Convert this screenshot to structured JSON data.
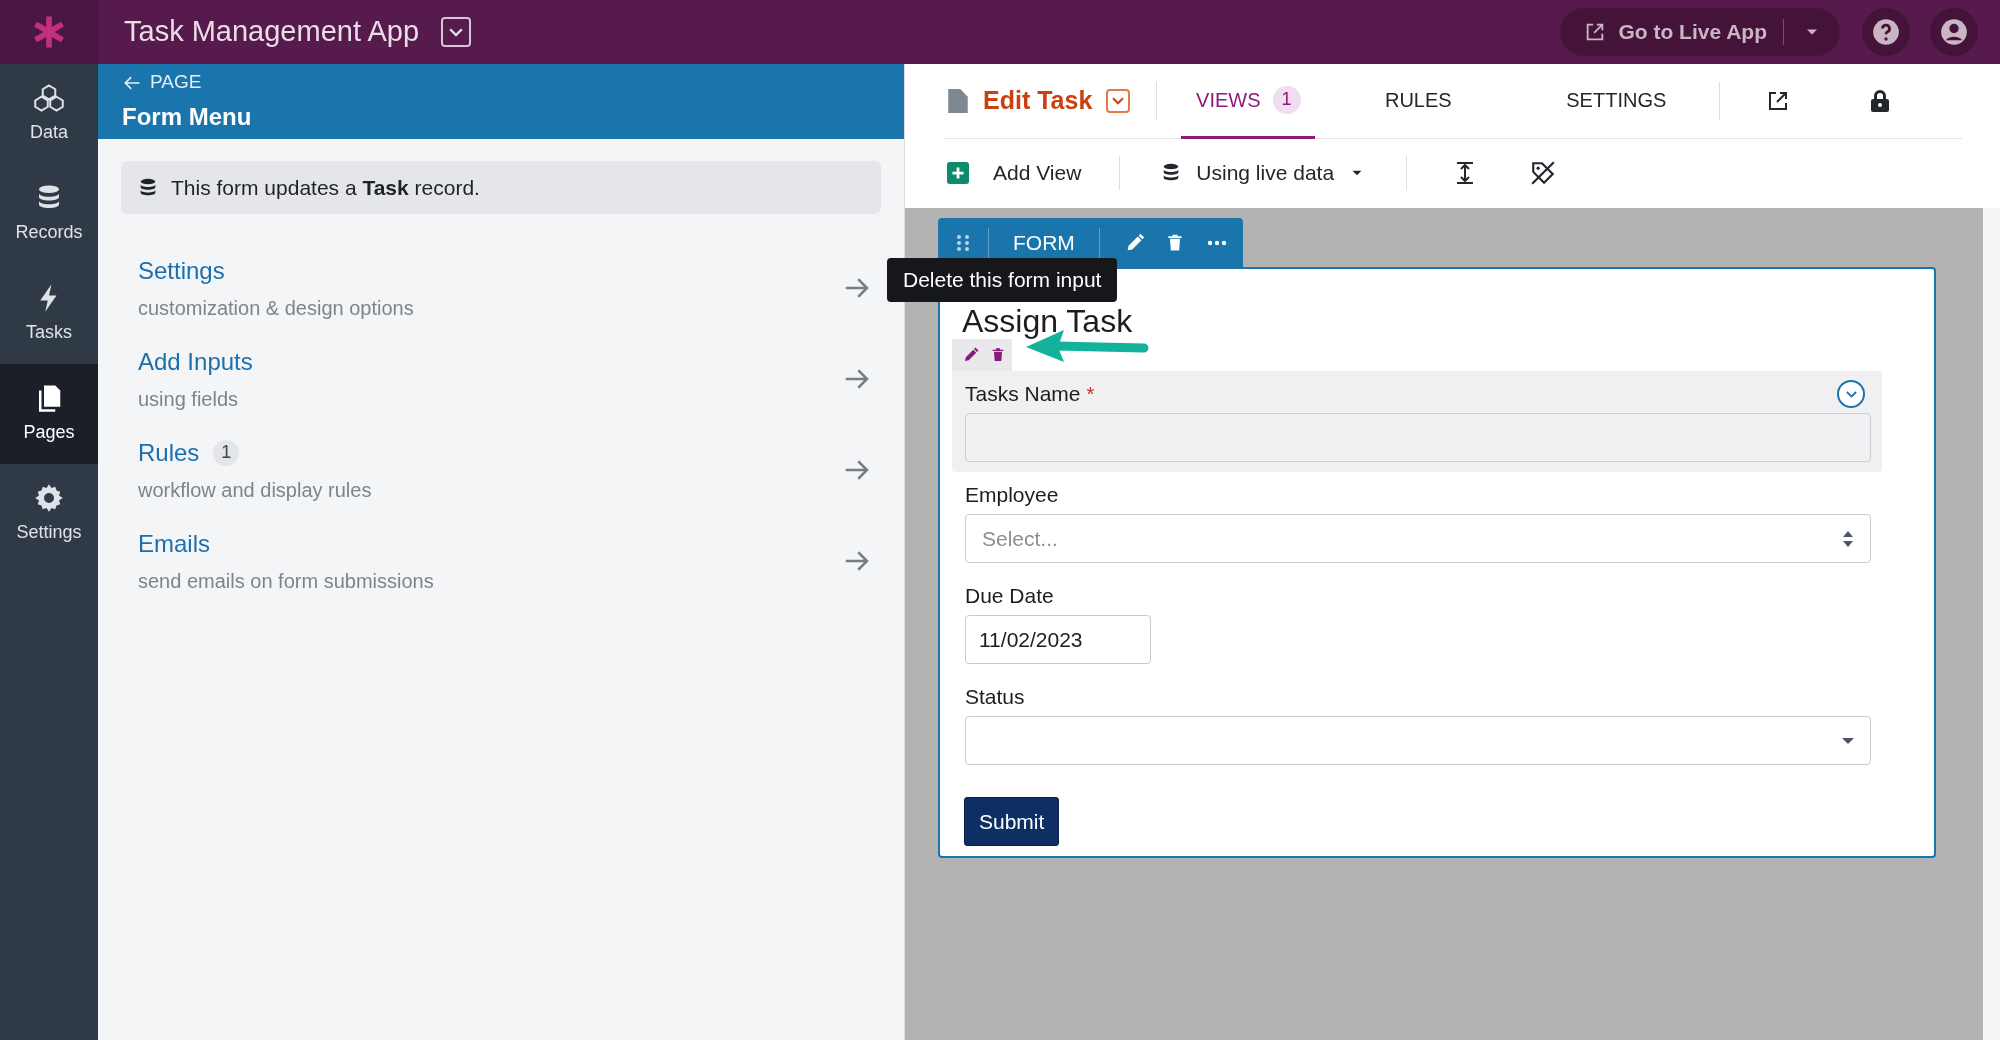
{
  "app_bar": {
    "title": "Task Management App",
    "live_app_button": "Go to Live App"
  },
  "nav": [
    {
      "label": "Data",
      "selected": false
    },
    {
      "label": "Records",
      "selected": false
    },
    {
      "label": "Tasks",
      "selected": false
    },
    {
      "label": "Pages",
      "selected": true
    },
    {
      "label": "Settings",
      "selected": false
    }
  ],
  "panel": {
    "back_label": "PAGE",
    "title": "Form Menu",
    "notice": "This form updates a **Task** record.",
    "items": [
      {
        "title": "Settings",
        "subtitle": "customization & design options"
      },
      {
        "title": "Add Inputs",
        "subtitle": "using fields"
      },
      {
        "title": "Rules",
        "count": "1",
        "subtitle": "workflow and display rules"
      },
      {
        "title": "Emails",
        "subtitle": "send emails on form submissions"
      }
    ]
  },
  "editor": {
    "page_name": "Edit Task",
    "tabs": [
      {
        "label": "VIEWS",
        "count": "1",
        "selected": true
      },
      {
        "label": "RULES",
        "selected": false
      },
      {
        "label": "SETTINGS",
        "selected": false
      }
    ],
    "toolbar": {
      "add_view": "Add View",
      "data_mode": "Using live data"
    }
  },
  "form": {
    "tab_label": "FORM",
    "tooltip": "Delete this form input",
    "title": "Assign Task",
    "fields": [
      {
        "kind": "text",
        "label": "Tasks Name",
        "required_mark": "*",
        "selected": true
      },
      {
        "kind": "select",
        "label": "Employee",
        "placeholder": "Select...",
        "selected": false
      },
      {
        "kind": "date",
        "label": "Due Date",
        "value": "11/02/2023",
        "selected": false
      },
      {
        "kind": "dropdown",
        "label": "Status",
        "selected": false
      }
    ],
    "submit": "Submit"
  }
}
